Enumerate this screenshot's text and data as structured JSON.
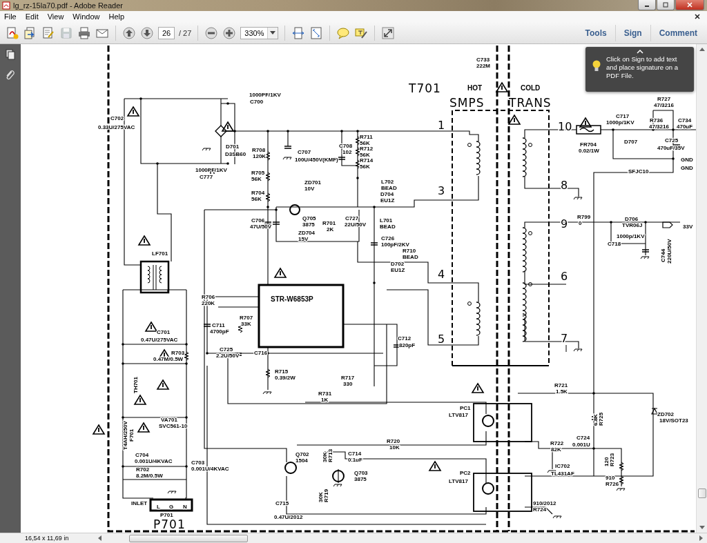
{
  "window": {
    "title": "lg_rz-15la70.pdf - Adobe Reader"
  },
  "menu": [
    {
      "label": "File"
    },
    {
      "label": "Edit"
    },
    {
      "label": "View"
    },
    {
      "label": "Window"
    },
    {
      "label": "Help"
    }
  ],
  "toolbar": {
    "page_field": "26",
    "page_count": "/ 27",
    "zoom_field": "330%",
    "save_disabled": true
  },
  "panels": [
    {
      "label": "Tools"
    },
    {
      "label": "Sign"
    },
    {
      "label": "Comment"
    }
  ],
  "tooltip": {
    "text": "Click on Sign to add text and place signature on a PDF File."
  },
  "document": {
    "labels": [
      {
        "text": "C733",
        "kind": "part"
      },
      {
        "text": "222M",
        "kind": "part"
      },
      {
        "text": "T701",
        "kind": "title"
      },
      {
        "text": "HOT",
        "kind": "heading"
      },
      {
        "text": "COLD",
        "kind": "heading"
      },
      {
        "text": "SMPS",
        "kind": "title"
      },
      {
        "text": "TRANS",
        "kind": "title"
      },
      {
        "text": "1000PF/1KV",
        "kind": "part"
      },
      {
        "text": "C700",
        "kind": "part"
      },
      {
        "text": "C702",
        "kind": "part"
      },
      {
        "text": "0.33U/275VAC",
        "kind": "part"
      },
      {
        "text": "D701",
        "kind": "part"
      },
      {
        "text": "D3SB60",
        "kind": "part"
      },
      {
        "text": "1000PF/1KV",
        "kind": "part"
      },
      {
        "text": "C777",
        "kind": "part"
      },
      {
        "text": "R708",
        "kind": "part"
      },
      {
        "text": "120K",
        "kind": "part"
      },
      {
        "text": "C707",
        "kind": "part"
      },
      {
        "text": "100U/450V(KMF)",
        "kind": "part"
      },
      {
        "text": "C708",
        "kind": "part"
      },
      {
        "text": "102",
        "kind": "part"
      },
      {
        "text": "R711",
        "kind": "part"
      },
      {
        "text": "56K",
        "kind": "part"
      },
      {
        "text": "R712",
        "kind": "part"
      },
      {
        "text": "56K",
        "kind": "part"
      },
      {
        "text": "R714",
        "kind": "part"
      },
      {
        "text": "56K",
        "kind": "part"
      },
      {
        "text": "R705",
        "kind": "part"
      },
      {
        "text": "56K",
        "kind": "part"
      },
      {
        "text": "R704",
        "kind": "part"
      },
      {
        "text": "56K",
        "kind": "part"
      },
      {
        "text": "ZD701",
        "kind": "part"
      },
      {
        "text": "10V",
        "kind": "part"
      },
      {
        "text": "L702",
        "kind": "part"
      },
      {
        "text": "BEAD",
        "kind": "part"
      },
      {
        "text": "D704",
        "kind": "part"
      },
      {
        "text": "EU1Z",
        "kind": "part"
      },
      {
        "text": "Q705",
        "kind": "part"
      },
      {
        "text": "3875",
        "kind": "part"
      },
      {
        "text": "R701",
        "kind": "part"
      },
      {
        "text": "2K",
        "kind": "part"
      },
      {
        "text": "C727",
        "kind": "part"
      },
      {
        "text": "22U/50V",
        "kind": "part"
      },
      {
        "text": "L701",
        "kind": "part"
      },
      {
        "text": "BEAD",
        "kind": "part"
      },
      {
        "text": "C706",
        "kind": "part"
      },
      {
        "text": "47U/50V",
        "kind": "part"
      },
      {
        "text": "ZD704",
        "kind": "part"
      },
      {
        "text": "15V",
        "kind": "part"
      },
      {
        "text": "C726",
        "kind": "part"
      },
      {
        "text": "100pF/2KV",
        "kind": "part"
      },
      {
        "text": "R710",
        "kind": "part"
      },
      {
        "text": "BEAD",
        "kind": "part"
      },
      {
        "text": "D702",
        "kind": "part"
      },
      {
        "text": "EU1Z",
        "kind": "part"
      },
      {
        "text": "1",
        "kind": "pin"
      },
      {
        "text": "3",
        "kind": "pin"
      },
      {
        "text": "4",
        "kind": "pin"
      },
      {
        "text": "5",
        "kind": "pin"
      },
      {
        "text": "10",
        "kind": "pin"
      },
      {
        "text": "8",
        "kind": "pin"
      },
      {
        "text": "9",
        "kind": "pin"
      },
      {
        "text": "6",
        "kind": "pin"
      },
      {
        "text": "7",
        "kind": "pin"
      },
      {
        "text": "FR704",
        "kind": "part"
      },
      {
        "text": "0.02/1W",
        "kind": "part"
      },
      {
        "text": "C717",
        "kind": "part"
      },
      {
        "text": "1000p/1KV",
        "kind": "part"
      },
      {
        "text": "R727",
        "kind": "part"
      },
      {
        "text": "47/3216",
        "kind": "part"
      },
      {
        "text": "R736",
        "kind": "part"
      },
      {
        "text": "47/3216",
        "kind": "part"
      },
      {
        "text": "D707",
        "kind": "part"
      },
      {
        "text": "C725",
        "kind": "part"
      },
      {
        "text": "470uF/35V",
        "kind": "part"
      },
      {
        "text": "C734",
        "kind": "part"
      },
      {
        "text": "470uF",
        "kind": "part"
      },
      {
        "text": "GND",
        "kind": "part"
      },
      {
        "text": "GND",
        "kind": "part"
      },
      {
        "text": "SFJC10",
        "kind": "part"
      },
      {
        "text": "R799",
        "kind": "part"
      },
      {
        "text": "0",
        "kind": "part"
      },
      {
        "text": "D706",
        "kind": "part"
      },
      {
        "text": "TVR06J",
        "kind": "part"
      },
      {
        "text": "33V",
        "kind": "part"
      },
      {
        "text": "1000p/1KV",
        "kind": "part"
      },
      {
        "text": "C718",
        "kind": "part"
      },
      {
        "text": "C744",
        "kind": "vertical"
      },
      {
        "text": "220U/50V",
        "kind": "vertical"
      },
      {
        "text": "LF701",
        "kind": "part"
      },
      {
        "text": "R706",
        "kind": "part"
      },
      {
        "text": "220K",
        "kind": "part"
      },
      {
        "text": "STR-W6853P",
        "kind": "heading"
      },
      {
        "text": "C711",
        "kind": "part"
      },
      {
        "text": "4700pF",
        "kind": "part"
      },
      {
        "text": "R707",
        "kind": "part"
      },
      {
        "text": "33K",
        "kind": "part"
      },
      {
        "text": "C725",
        "kind": "part"
      },
      {
        "text": "2.2U/50V",
        "kind": "part"
      },
      {
        "text": "C716",
        "kind": "part"
      },
      {
        "text": "R715",
        "kind": "part"
      },
      {
        "text": "0.39/2W",
        "kind": "part"
      },
      {
        "text": "C712",
        "kind": "part"
      },
      {
        "text": "820pF",
        "kind": "part"
      },
      {
        "text": "R717",
        "kind": "part"
      },
      {
        "text": "330",
        "kind": "part"
      },
      {
        "text": "R731",
        "kind": "part"
      },
      {
        "text": "1K",
        "kind": "part"
      },
      {
        "text": "C701",
        "kind": "part"
      },
      {
        "text": "0.47U/275VAC",
        "kind": "part"
      },
      {
        "text": "R703",
        "kind": "part"
      },
      {
        "text": "0.47M/0.5W",
        "kind": "part"
      },
      {
        "text": "TH701",
        "kind": "vertical"
      },
      {
        "text": "VA701",
        "kind": "part"
      },
      {
        "text": "SVC561-10",
        "kind": "part"
      },
      {
        "text": "T4AH/250V",
        "kind": "vertical"
      },
      {
        "text": "F701",
        "kind": "vertical"
      },
      {
        "text": "C704",
        "kind": "part"
      },
      {
        "text": "0.001U/4KVAC",
        "kind": "part"
      },
      {
        "text": "R702",
        "kind": "part"
      },
      {
        "text": "8.2M/0.5W",
        "kind": "part"
      },
      {
        "text": "C703",
        "kind": "part"
      },
      {
        "text": "0.001U/4KVAC",
        "kind": "part"
      },
      {
        "text": "INLET",
        "kind": "part"
      },
      {
        "text": "L",
        "kind": "part"
      },
      {
        "text": "G",
        "kind": "part"
      },
      {
        "text": "N",
        "kind": "part"
      },
      {
        "text": "P701",
        "kind": "part"
      },
      {
        "text": "P701",
        "kind": "title"
      },
      {
        "text": "Q702",
        "kind": "part"
      },
      {
        "text": "1504",
        "kind": "part"
      },
      {
        "text": "R713",
        "kind": "vertical"
      },
      {
        "text": "30K",
        "kind": "vertical"
      },
      {
        "text": "C714",
        "kind": "part"
      },
      {
        "text": "0.1uF",
        "kind": "part"
      },
      {
        "text": "Q703",
        "kind": "part"
      },
      {
        "text": "3875",
        "kind": "part"
      },
      {
        "text": "R719",
        "kind": "vertical"
      },
      {
        "text": "30K",
        "kind": "vertical"
      },
      {
        "text": "C715",
        "kind": "part"
      },
      {
        "text": "0.47U/2012",
        "kind": "part"
      },
      {
        "text": "R720",
        "kind": "part"
      },
      {
        "text": "10K",
        "kind": "part"
      },
      {
        "text": "PC1",
        "kind": "part"
      },
      {
        "text": "LTV817",
        "kind": "part"
      },
      {
        "text": "PC2",
        "kind": "part"
      },
      {
        "text": "LTV817",
        "kind": "part"
      },
      {
        "text": "R721",
        "kind": "part"
      },
      {
        "text": "1.5K",
        "kind": "part"
      },
      {
        "text": "R725",
        "kind": "vertical"
      },
      {
        "text": "6.8K",
        "kind": "vertical"
      },
      {
        "text": "ZD702",
        "kind": "part"
      },
      {
        "text": "18V/SOT23",
        "kind": "part"
      },
      {
        "text": "R722",
        "kind": "part"
      },
      {
        "text": "82K",
        "kind": "part"
      },
      {
        "text": "C724",
        "kind": "part"
      },
      {
        "text": "0.001U",
        "kind": "part"
      },
      {
        "text": "IC702",
        "kind": "part"
      },
      {
        "text": "TL431AF",
        "kind": "part"
      },
      {
        "text": "R723",
        "kind": "vertical"
      },
      {
        "text": "120",
        "kind": "vertical"
      },
      {
        "text": "910",
        "kind": "part"
      },
      {
        "text": "R726",
        "kind": "part"
      },
      {
        "text": "910/2012",
        "kind": "part"
      },
      {
        "text": "R724",
        "kind": "part"
      }
    ]
  },
  "status_bar": {
    "page_size": "16,54 x 11,69 in"
  }
}
